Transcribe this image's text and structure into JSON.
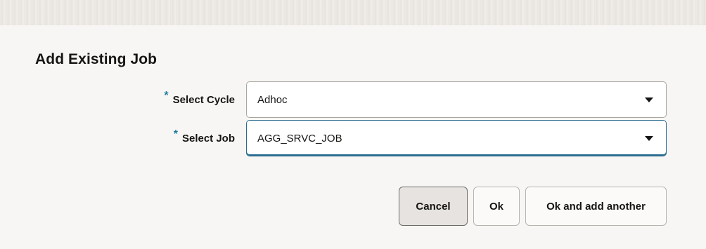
{
  "dialog": {
    "title": "Add Existing Job",
    "required_marker": "*"
  },
  "fields": {
    "cycle": {
      "label": "Select Cycle",
      "value": "Adhoc"
    },
    "job": {
      "label": "Select Job",
      "value": "AGG_SRVC_JOB"
    }
  },
  "buttons": {
    "cancel": "Cancel",
    "ok": "Ok",
    "ok_and_add_another": "Ok and add another"
  },
  "colors": {
    "required_marker": "#227d9e",
    "focus_border": "#2a6c90"
  },
  "icons": {
    "dropdown": "caret-down-icon"
  }
}
